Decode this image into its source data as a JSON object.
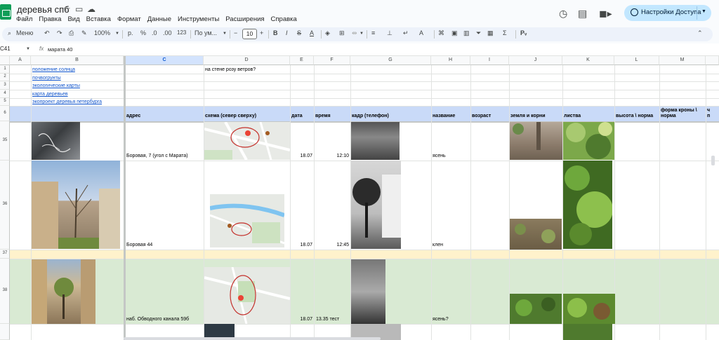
{
  "app": {
    "doc_title": "деревья спб",
    "menu": [
      "Файл",
      "Правка",
      "Вид",
      "Вставка",
      "Формат",
      "Данные",
      "Инструменты",
      "Расширения",
      "Справка"
    ],
    "share_label": "Настройки Доступа",
    "brand_color": "#0f9d58",
    "share_bg": "#c2e7ff"
  },
  "toolbar": {
    "menu_label": "Меню",
    "zoom": "100%",
    "currency": "р.",
    "percent": "%",
    "dec_less": ".0",
    "dec_more": ".00",
    "num_fmt": "123",
    "font": "По ум...",
    "font_size": "10"
  },
  "formula_bar": {
    "cell_ref": "C41",
    "fx": "fx",
    "value": "марата 40"
  },
  "grid": {
    "columns": [
      "A",
      "B",
      "C",
      "D",
      "E",
      "F",
      "G",
      "H",
      "I",
      "J",
      "K",
      "L",
      "M"
    ],
    "selected_column": "C",
    "row_numbers": [
      "1",
      "2",
      "3",
      "4",
      "5",
      "6",
      "35",
      "36",
      "37",
      "38"
    ],
    "links": [
      "положение солнца",
      "почвогрунты",
      "экологические карты",
      "карта деревьев",
      "экопроект деревья петербурга"
    ],
    "note_d1": "на стене розу ветров?",
    "headers": {
      "address": "адрес",
      "scheme": "схема (север сверху)",
      "date": "дата",
      "time": "время",
      "frame": "кадр (телефон)",
      "name": "название",
      "age": "возраст",
      "soil": "земля и корни",
      "leaves": "листва",
      "height": "высота \\ норма",
      "crown_1": "форма кроны \\",
      "crown_2": "норма",
      "cut_n": "ч",
      "cut_n2": "п"
    },
    "rows": [
      {
        "address": "Боровая, 7 (угол с Марата)",
        "date": "18.07",
        "time": "12:10",
        "name": "ясень"
      },
      {
        "address": "Боровая 44",
        "date": "18.07",
        "time": "12:45",
        "name": "клен"
      },
      {
        "address": "наб. Обводного канала 59б",
        "date": "18.07",
        "time": "13.35 тест",
        "name": "ясень?"
      }
    ]
  },
  "colors": {
    "header_row": "#c9daf8",
    "row_37": "#fff2cc",
    "row_38": "#d9ead3",
    "link": "#1155cc",
    "selection": "#d3e3fd"
  }
}
